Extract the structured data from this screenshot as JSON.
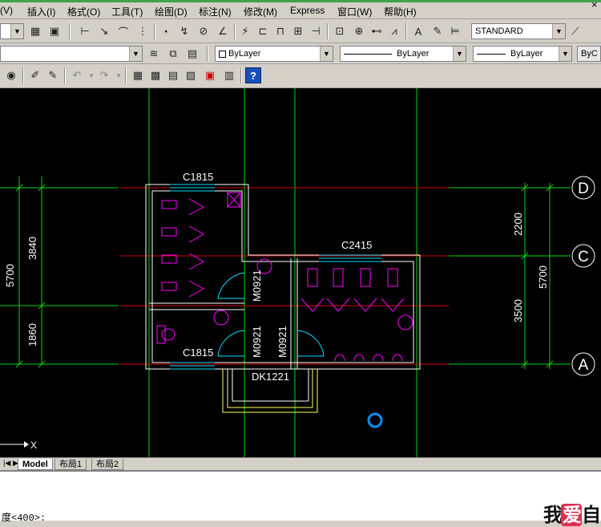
{
  "menubar": {
    "items": [
      "(V)",
      "插入(I)",
      "格式(O)",
      "工具(T)",
      "绘图(D)",
      "标注(N)",
      "修改(M)",
      "Express",
      "窗口(W)",
      "帮助(H)"
    ],
    "close_glyph": "×"
  },
  "toolbar1": {
    "text_style": "STANDARD"
  },
  "toolbar2": {
    "layer": "",
    "color": "ByLayer",
    "linetype": "ByLayer",
    "lineweight": "ByLayer",
    "plotstyle": "ByC"
  },
  "drawing": {
    "window_labels": [
      "C1815",
      "C2415",
      "C1815"
    ],
    "door_labels": [
      "M0921",
      "M0921",
      "M0921"
    ],
    "entrance_label": "DK1221",
    "grid_bubbles": [
      "D",
      "C",
      "A"
    ],
    "left_dimensions": [
      "5700",
      "3840",
      "1860"
    ],
    "right_dimensions": [
      "2200",
      "3500",
      "5700"
    ],
    "ucs_axis": "X"
  },
  "tabs": [
    "Model",
    "布局1",
    "布局2"
  ],
  "command": {
    "prompt": "度<400>:"
  },
  "watermark": {
    "text1": "我",
    "text2": "爱",
    "text3": "自"
  },
  "colors": {
    "grid_green": "#00d800",
    "grid_red": "#d40000",
    "wall_white": "#ffffff",
    "fixture_magenta": "#ff00ff",
    "door_cyan": "#00e0ff",
    "entrance_yellow": "#ffff66",
    "ucs_blue": "#0a8cff"
  }
}
